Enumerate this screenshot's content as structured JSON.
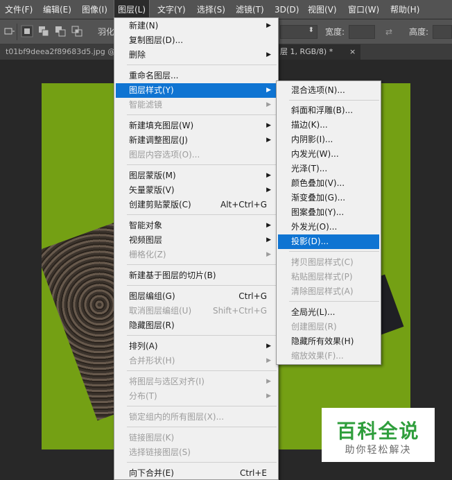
{
  "menubar": {
    "items": [
      "文件(F)",
      "编辑(E)",
      "图像(I)",
      "图层(L)",
      "文字(Y)",
      "选择(S)",
      "滤镜(T)",
      "3D(D)",
      "视图(V)",
      "窗口(W)",
      "帮助(H)"
    ]
  },
  "options": {
    "feather_label": "羽化",
    "width_label": "宽度:",
    "height_label": "高度:"
  },
  "tabs": {
    "left": "t01bf9deea2f89683d5.jpg @",
    "right": "层 1, RGB/8) *",
    "close": "×"
  },
  "layer_menu": {
    "new": "新建(N)",
    "duplicate": "复制图层(D)...",
    "delete": "删除",
    "rename": "重命名图层...",
    "style": "图层样式(Y)",
    "smart_filter": "智能滤镜",
    "new_fill": "新建填充图层(W)",
    "new_adjust": "新建调整图层(J)",
    "content_opts": "图层内容选项(O)...",
    "layer_mask": "图层蒙版(M)",
    "vector_mask": "矢量蒙版(V)",
    "clip_mask": "创建剪贴蒙版(C)",
    "clip_mask_sc": "Alt+Ctrl+G",
    "smart_object": "智能对象",
    "video_layer": "视频图层",
    "rasterize": "栅格化(Z)",
    "slice": "新建基于图层的切片(B)",
    "group": "图层编组(G)",
    "group_sc": "Ctrl+G",
    "ungroup": "取消图层编组(U)",
    "ungroup_sc": "Shift+Ctrl+G",
    "hide": "隐藏图层(R)",
    "arrange": "排列(A)",
    "combine": "合并形状(H)",
    "align": "将图层与选区对齐(I)",
    "distribute": "分布(T)",
    "lock_all": "锁定组内的所有图层(X)...",
    "link": "链接图层(K)",
    "select_linked": "选择链接图层(S)",
    "merge_down": "向下合并(E)",
    "merge_down_sc": "Ctrl+E"
  },
  "style_menu": {
    "blend": "混合选项(N)...",
    "bevel": "斜面和浮雕(B)...",
    "stroke": "描边(K)...",
    "inner_shadow": "内阴影(I)...",
    "inner_glow": "内发光(W)...",
    "satin": "光泽(T)...",
    "color_overlay": "颜色叠加(V)...",
    "gradient_overlay": "渐变叠加(G)...",
    "pattern_overlay": "图案叠加(Y)...",
    "outer_glow": "外发光(O)...",
    "drop_shadow": "投影(D)...",
    "copy_style": "拷贝图层样式(C)",
    "paste_style": "粘贴图层样式(P)",
    "clear_style": "清除图层样式(A)",
    "global_light": "全局光(L)...",
    "create_layers": "创建图层(R)",
    "hide_effects": "隐藏所有效果(H)",
    "scale_effects": "缩放效果(F)..."
  },
  "watermark": {
    "title": "百科全说",
    "subtitle": "助你轻松解决"
  },
  "colors": {
    "accent": "#0f74d2",
    "canvas": "#74a014",
    "watermark_green": "#2f9e3c"
  }
}
